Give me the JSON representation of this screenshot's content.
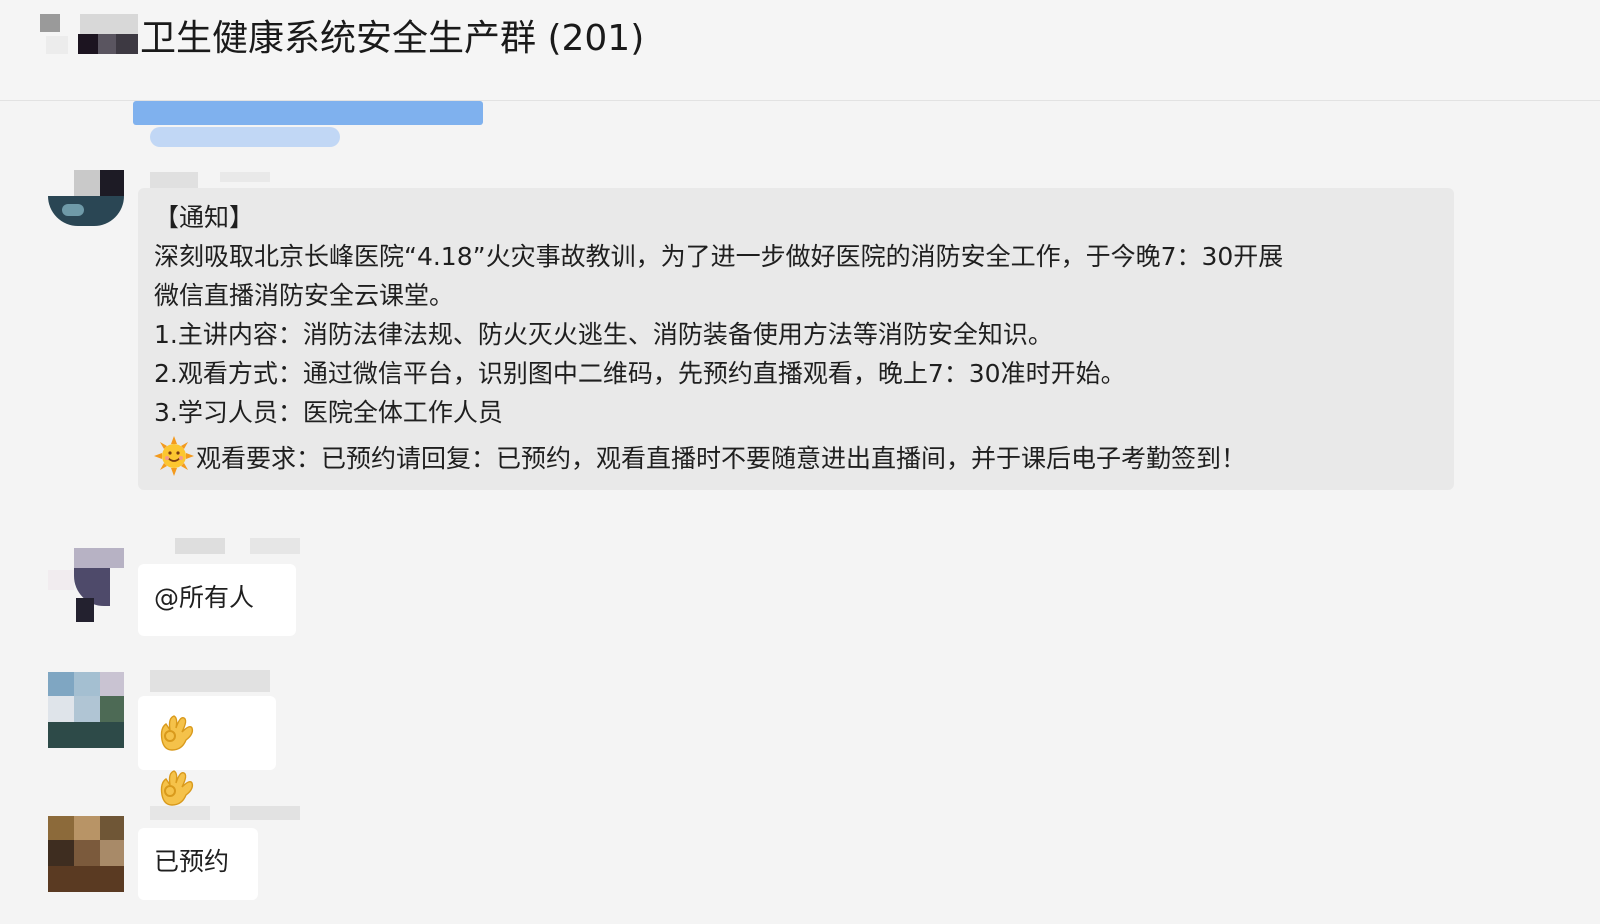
{
  "header": {
    "title": "卫生健康系统安全生产群 (201)",
    "avatar_icon": "group-avatar-icon"
  },
  "messages": [
    {
      "type": "notice",
      "lines": [
        "【通知】",
        "深刻吸取北京长峰医院“4.18”火灾事故教训，为了进一步做好医院的消防安全工作，于今晚7：30开展",
        "微信直播消防安全云课堂。",
        "1.主讲内容：消防法律法规、防火灭火逃生、消防装备使用方法等消防安全知识。",
        "2.观看方式：通过微信平台，识别图中二维码，先预约直播观看，晚上7：30准时开始。",
        "3.学习人员：医院全体工作人员",
        "观看要求：已预约请回复：已预约，观看直播时不要随意进出直播间，并于课后电子考勤签到！"
      ],
      "emoji_icon": "sun-face-icon"
    },
    {
      "type": "text",
      "text": "@所有人"
    },
    {
      "type": "emoji",
      "emoji_icon": "ok-hand-icon",
      "count": 2
    },
    {
      "type": "text",
      "text": "已预约"
    }
  ],
  "colors": {
    "background": "#f4f4f4",
    "notice_bubble": "#e9e9e9",
    "text_bubble": "#ffffff",
    "pinned_bar": "#6aa4ec"
  }
}
